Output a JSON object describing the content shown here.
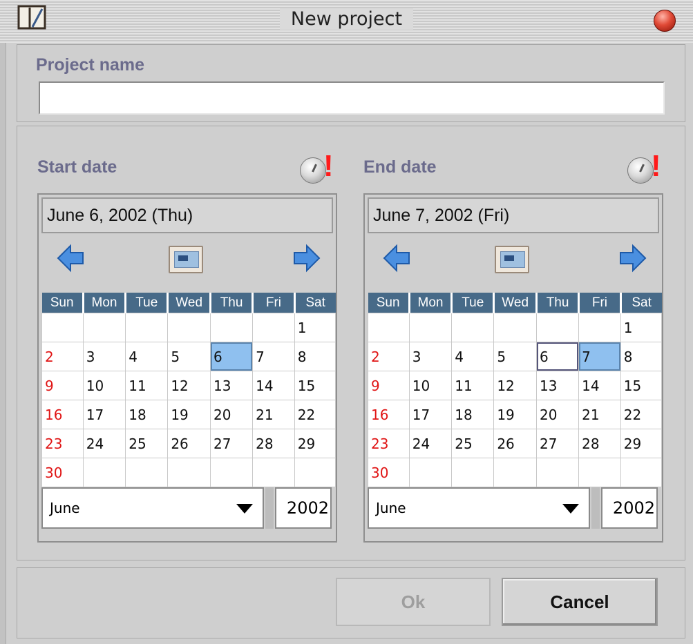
{
  "window": {
    "title": "New project"
  },
  "project_name": {
    "label": "Project name",
    "value": ""
  },
  "start": {
    "label": "Start date",
    "header": "June 6, 2002 (Thu)",
    "month": "June",
    "year": "2002",
    "selected": "6",
    "today": "",
    "days": [
      "Sun",
      "Mon",
      "Tue",
      "Wed",
      "Thu",
      "Fri",
      "Sat"
    ],
    "weeks": [
      [
        "",
        "",
        "",
        "",
        "",
        "",
        "1"
      ],
      [
        "2",
        "3",
        "4",
        "5",
        "6",
        "7",
        "8"
      ],
      [
        "9",
        "10",
        "11",
        "12",
        "13",
        "14",
        "15"
      ],
      [
        "16",
        "17",
        "18",
        "19",
        "20",
        "21",
        "22"
      ],
      [
        "23",
        "24",
        "25",
        "26",
        "27",
        "28",
        "29"
      ],
      [
        "30",
        "",
        "",
        "",
        "",
        "",
        ""
      ]
    ]
  },
  "end": {
    "label": "End date",
    "header": "June 7, 2002 (Fri)",
    "month": "June",
    "year": "2002",
    "selected": "7",
    "today": "6",
    "days": [
      "Sun",
      "Mon",
      "Tue",
      "Wed",
      "Thu",
      "Fri",
      "Sat"
    ],
    "weeks": [
      [
        "",
        "",
        "",
        "",
        "",
        "",
        "1"
      ],
      [
        "2",
        "3",
        "4",
        "5",
        "6",
        "7",
        "8"
      ],
      [
        "9",
        "10",
        "11",
        "12",
        "13",
        "14",
        "15"
      ],
      [
        "16",
        "17",
        "18",
        "19",
        "20",
        "21",
        "22"
      ],
      [
        "23",
        "24",
        "25",
        "26",
        "27",
        "28",
        "29"
      ],
      [
        "30",
        "",
        "",
        "",
        "",
        "",
        ""
      ]
    ]
  },
  "buttons": {
    "ok": "Ok",
    "cancel": "Cancel"
  },
  "colors": {
    "accent_blue": "#476a88",
    "selected_day": "#8fc0ef",
    "sunday": "#e01515",
    "label": "#6b6b8c",
    "alarm": "#ff1a1a"
  },
  "icons": [
    "app-icon",
    "close-icon",
    "alarm-clock-icon",
    "prev-month-icon",
    "next-month-icon",
    "today-icon",
    "dropdown-arrow-icon"
  ]
}
